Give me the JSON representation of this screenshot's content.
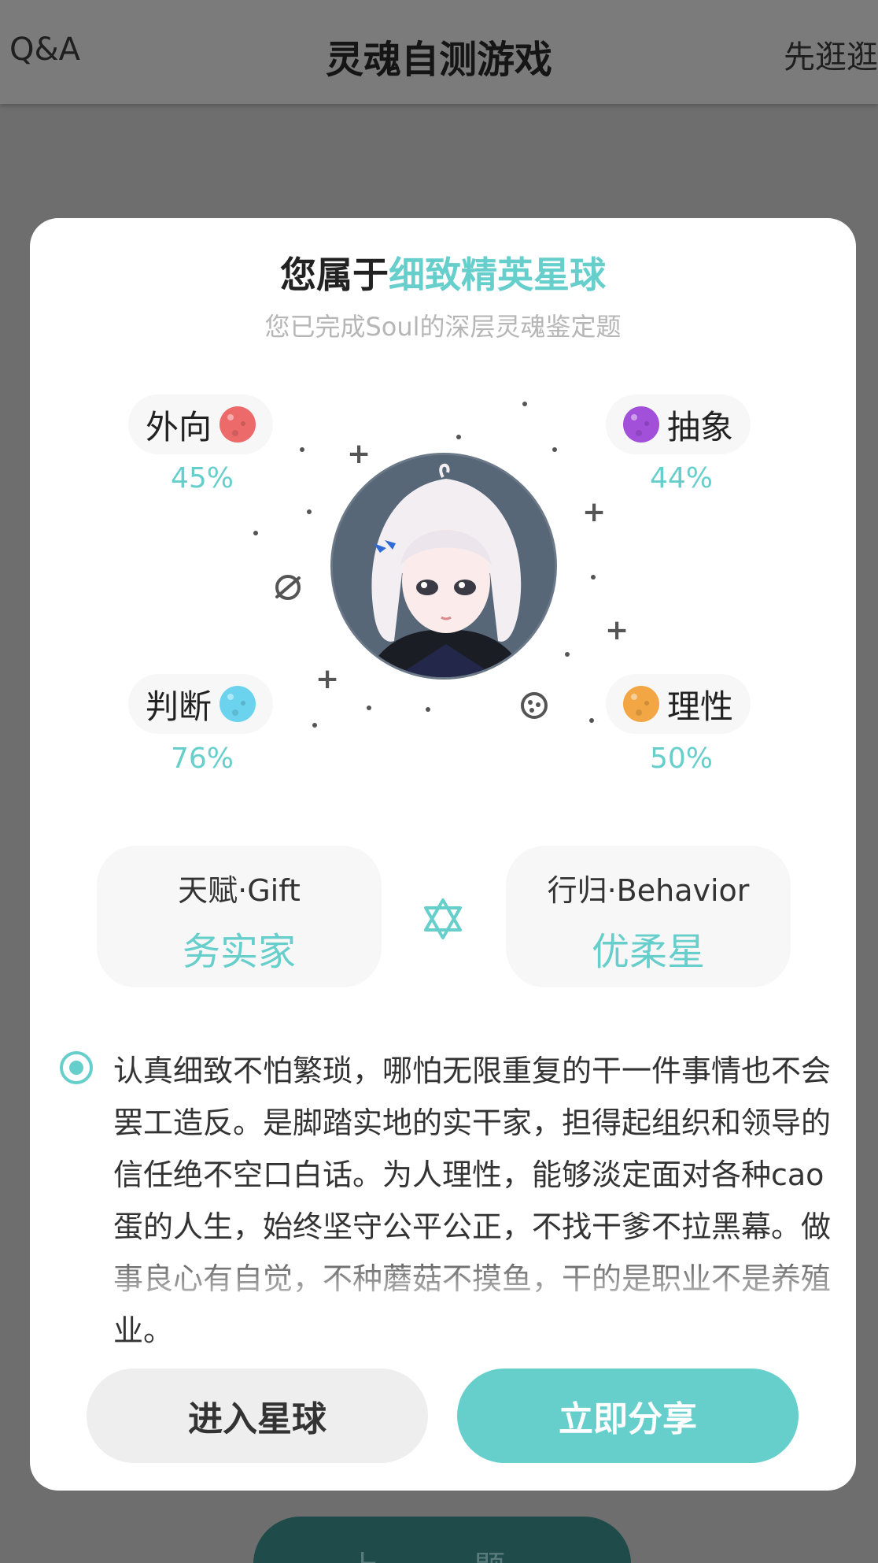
{
  "header": {
    "left_label": "Q&A",
    "title": "灵魂自测游戏",
    "right_label": "先逛逛"
  },
  "background_button": {
    "label": "上一题"
  },
  "result": {
    "title_prefix": "您属于",
    "title_planet": "细致精英星球",
    "subtitle": "您已完成Soul的深层灵魂鉴定题",
    "traits": [
      {
        "label": "外向",
        "percent": "45%",
        "color": "#ec6a6a",
        "icon": "red-planet-icon"
      },
      {
        "label": "抽象",
        "percent": "44%",
        "color": "#a24fd9",
        "icon": "purple-planet-icon"
      },
      {
        "label": "判断",
        "percent": "76%",
        "color": "#6cd3ee",
        "icon": "blue-planet-icon"
      },
      {
        "label": "理性",
        "percent": "50%",
        "color": "#f3a744",
        "icon": "orange-planet-icon"
      }
    ],
    "gift": {
      "label": "天赋·Gift",
      "value": "务实家"
    },
    "behavior": {
      "label": "行归·Behavior",
      "value": "优柔星"
    },
    "description": "认真细致不怕繁琐，哪怕无限重复的干一件事情也不会罢工造反。是脚踏实地的实干家，担得起组织和领导的信任绝不空口白话。为人理性，能够淡定面对各种cao蛋的人生，始终坚守公平公正，不找干爹不拉黑幕。做事良心有自觉，不种蘑菇不摸鱼，干的是职业不是养殖业。"
  },
  "buttons": {
    "enter": "进入星球",
    "share": "立即分享"
  },
  "colors": {
    "accent": "#66cfcc",
    "overlay": "#6e6e6e"
  }
}
